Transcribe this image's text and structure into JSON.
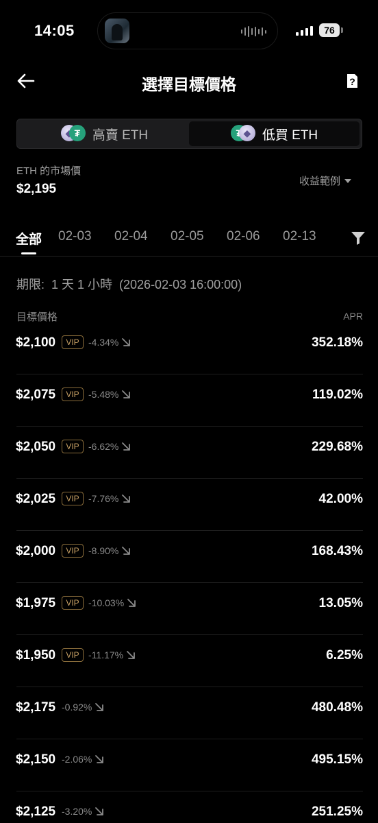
{
  "status_bar": {
    "time": "14:05",
    "battery": "76"
  },
  "header": {
    "title": "選擇目標價格"
  },
  "segment": {
    "left": {
      "label": "高賣 ETH"
    },
    "right": {
      "label": "低買 ETH"
    }
  },
  "market": {
    "label": "ETH 的市場價",
    "price": "$2,195",
    "profit_example": "收益範例"
  },
  "tabs": [
    {
      "label": "全部",
      "active": true
    },
    {
      "label": "02-03"
    },
    {
      "label": "02-04"
    },
    {
      "label": "02-05"
    },
    {
      "label": "02-06"
    },
    {
      "label": "02-13"
    }
  ],
  "expiry": "期限:  1 天 1 小時  (2026-02-03 16:00:00)",
  "list": {
    "col_target": "目標價格",
    "col_apr": "APR",
    "vip_label": "VIP",
    "rows": [
      {
        "price": "$2,100",
        "vip": true,
        "change": "-4.34%",
        "apr": "352.18%"
      },
      {
        "price": "$2,075",
        "vip": true,
        "change": "-5.48%",
        "apr": "119.02%"
      },
      {
        "price": "$2,050",
        "vip": true,
        "change": "-6.62%",
        "apr": "229.68%"
      },
      {
        "price": "$2,025",
        "vip": true,
        "change": "-7.76%",
        "apr": "42.00%"
      },
      {
        "price": "$2,000",
        "vip": true,
        "change": "-8.90%",
        "apr": "168.43%"
      },
      {
        "price": "$1,975",
        "vip": true,
        "change": "-10.03%",
        "apr": "13.05%"
      },
      {
        "price": "$1,950",
        "vip": true,
        "change": "-11.17%",
        "apr": "6.25%"
      },
      {
        "price": "$2,175",
        "vip": false,
        "change": "-0.92%",
        "apr": "480.48%"
      },
      {
        "price": "$2,150",
        "vip": false,
        "change": "-2.06%",
        "apr": "495.15%"
      },
      {
        "price": "$2,125",
        "vip": false,
        "change": "-3.20%",
        "apr": "251.25%"
      }
    ]
  }
}
